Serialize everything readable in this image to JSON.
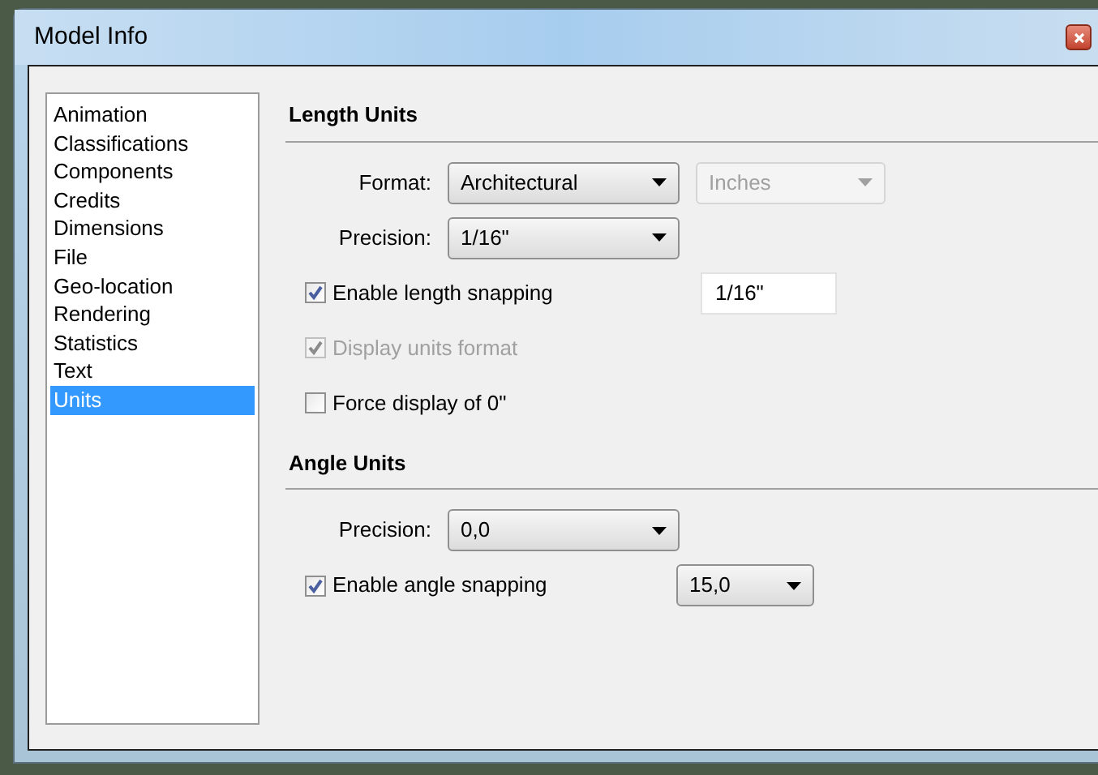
{
  "window": {
    "title": "Model Info"
  },
  "sidebar": {
    "items": [
      {
        "label": "Animation",
        "selected": false
      },
      {
        "label": "Classifications",
        "selected": false
      },
      {
        "label": "Components",
        "selected": false
      },
      {
        "label": "Credits",
        "selected": false
      },
      {
        "label": "Dimensions",
        "selected": false
      },
      {
        "label": "File",
        "selected": false
      },
      {
        "label": "Geo-location",
        "selected": false
      },
      {
        "label": "Rendering",
        "selected": false
      },
      {
        "label": "Statistics",
        "selected": false
      },
      {
        "label": "Text",
        "selected": false
      },
      {
        "label": "Units",
        "selected": true
      }
    ]
  },
  "sections": [
    {
      "title": "Length Units",
      "rows": [
        {
          "kind": "selects",
          "label": "Format:",
          "selects": [
            {
              "value": "Architectural",
              "disabled": false
            },
            {
              "value": "Inches",
              "disabled": true
            }
          ]
        },
        {
          "kind": "selects",
          "label": "Precision:",
          "selects": [
            {
              "value": "1/16\"",
              "disabled": false
            }
          ]
        },
        {
          "kind": "checkbox",
          "label": "Enable length snapping",
          "checked": true,
          "disabled": false,
          "field": {
            "kind": "input",
            "value": "1/16\""
          }
        },
        {
          "kind": "checkbox",
          "label": "Display units format",
          "checked": true,
          "disabled": true
        },
        {
          "kind": "checkbox",
          "label": "Force display of 0\"",
          "checked": false,
          "disabled": false
        }
      ]
    },
    {
      "title": "Angle Units",
      "rows": [
        {
          "kind": "selects",
          "label": "Precision:",
          "selects": [
            {
              "value": "0,0",
              "disabled": false
            }
          ]
        },
        {
          "kind": "checkbox",
          "label": "Enable angle snapping",
          "checked": true,
          "disabled": false,
          "field": {
            "kind": "select",
            "value": "15,0"
          }
        }
      ]
    }
  ]
}
